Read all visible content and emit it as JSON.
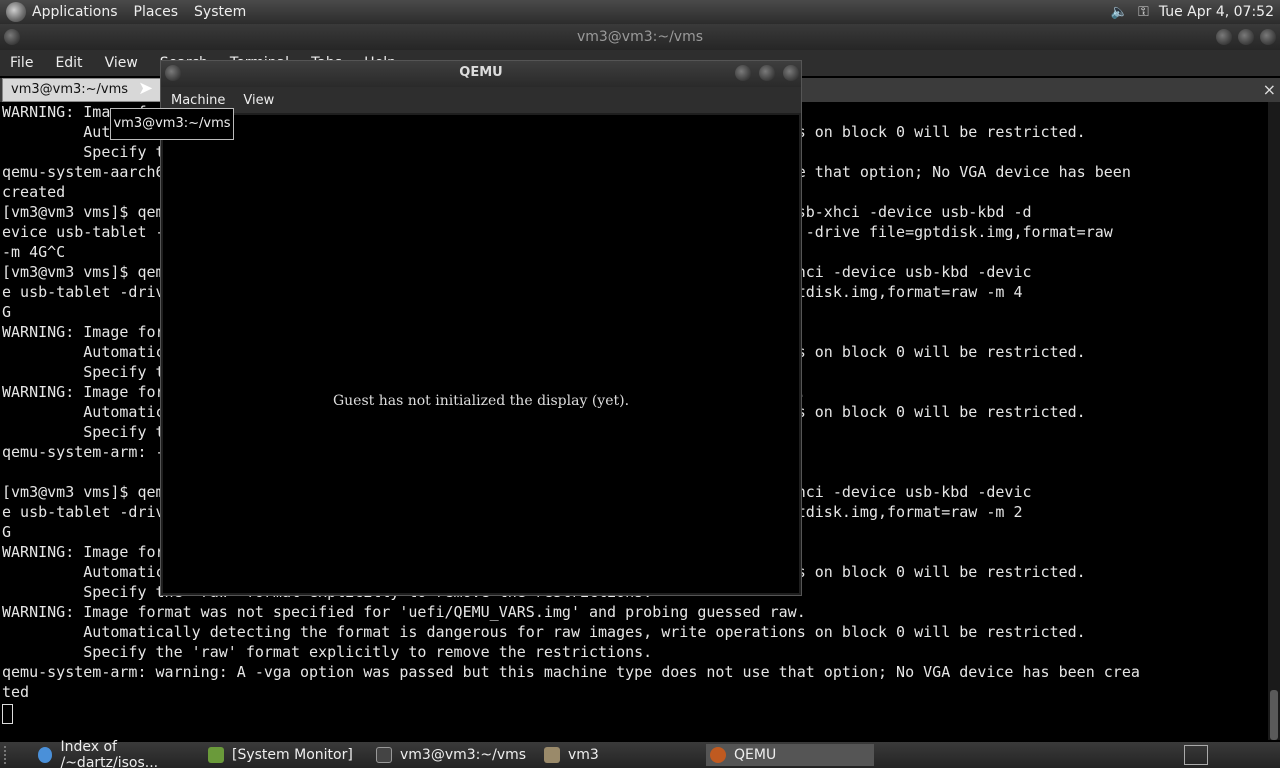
{
  "top_panel": {
    "menus": [
      "Applications",
      "Places",
      "System"
    ],
    "clock": "Tue Apr  4, 07:52",
    "volume_icon": "speaker-icon",
    "network_icon": "key-icon"
  },
  "terminal_window": {
    "title": "vm3@vm3:~/vms",
    "menus": [
      "File",
      "Edit",
      "View",
      "Search",
      "Terminal",
      "Tabs",
      "Help"
    ],
    "tab_label": "vm3@vm3:~/vms",
    "lines": [
      "WARNING: Image format was not specified for 'uefi/QEMU_EFI.img' and probing guessed raw.",
      "         Automatically detecting the format is dangerous for raw images, write operations on block 0 will be restricted.",
      "         Specify the 'raw' format explicitly to remove the restrictions.",
      "qemu-system-aarch64: warning: A -vga option was passed but this machine type does not use that option; No VGA device has been",
      "created",
      "[vm3@vm3 vms]$ qemu-system-aarch64 -M virt -cpu cortex-a57 -vga std -smp 2 -device nec-usb-xhci -device usb-kbd -d",
      "evice usb-tablet -drive file=uefi/QEMU_EFI.img,format=raw -drive file=uefi/QEMU_VARS.img -drive file=gptdisk.img,format=raw",
      "-m 4G^C",
      "[vm3@vm3 vms]$ qemu-system-arm -M virt -cpu cortex-a15 -vga std -smp 2 -device nec-usb-xhci -device usb-kbd -devic",
      "e usb-tablet -drive file=uefi/QEMU_EFI.img -drive file=uefi/QEMU_VARS.img -drive file=gptdisk.img,format=raw -m 4",
      "G",
      "WARNING: Image format was not specified for 'uefi/QEMU_EFI.img' and probing guessed raw.",
      "         Automatically detecting the format is dangerous for raw images, write operations on block 0 will be restricted.",
      "         Specify the 'raw' format explicitly to remove the restrictions.",
      "WARNING: Image format was not specified for 'uefi/QEMU_VARS.img' and probing guessed raw.",
      "         Automatically detecting the format is dangerous for raw images, write operations on block 0 will be restricted.",
      "         Specify the 'raw' format explicitly to remove the restrictions.",
      "qemu-system-arm: -m 4G: ram size too large for this machine: 4294967296 > 824 bytes",
      "",
      "[vm3@vm3 vms]$ qemu-system-arm -M virt -cpu cortex-a15 -vga std -smp 2 -device nec-usb-xhci -device usb-kbd -devic",
      "e usb-tablet -drive file=uefi/QEMU_EFI.img -drive file=uefi/QEMU_VARS.img -drive file=gptdisk.img,format=raw -m 2",
      "G",
      "WARNING: Image format was not specified for 'uefi/QEMU_EFI.img' and probing guessed raw.",
      "         Automatically detecting the format is dangerous for raw images, write operations on block 0 will be restricted.",
      "         Specify the 'raw' format explicitly to remove the restrictions.",
      "WARNING: Image format was not specified for 'uefi/QEMU_VARS.img' and probing guessed raw.",
      "         Automatically detecting the format is dangerous for raw images, write operations on block 0 will be restricted.",
      "         Specify the 'raw' format explicitly to remove the restrictions.",
      "qemu-system-arm: warning: A -vga option was passed but this machine type does not use that option; No VGA device has been crea",
      "ted"
    ]
  },
  "qemu_window": {
    "title": "QEMU",
    "menus": [
      "Machine",
      "View"
    ],
    "message": "Guest has not initialized the display (yet)."
  },
  "tooltip": "vm3@vm3:~/vms",
  "taskbar": [
    {
      "label": "Index of /~dartz/isos...",
      "icon": "chrome-icon",
      "color": "#4a90d9"
    },
    {
      "label": "[System Monitor]",
      "icon": "system-monitor-icon",
      "color": "#6a9a3a"
    },
    {
      "label": "vm3@vm3:~/vms",
      "icon": "terminal-icon",
      "color": "#444444"
    },
    {
      "label": "vm3",
      "icon": "folder-icon",
      "color": "#9a8a6a"
    },
    {
      "label": "QEMU",
      "icon": "qemu-icon",
      "color": "#c05a20"
    }
  ]
}
